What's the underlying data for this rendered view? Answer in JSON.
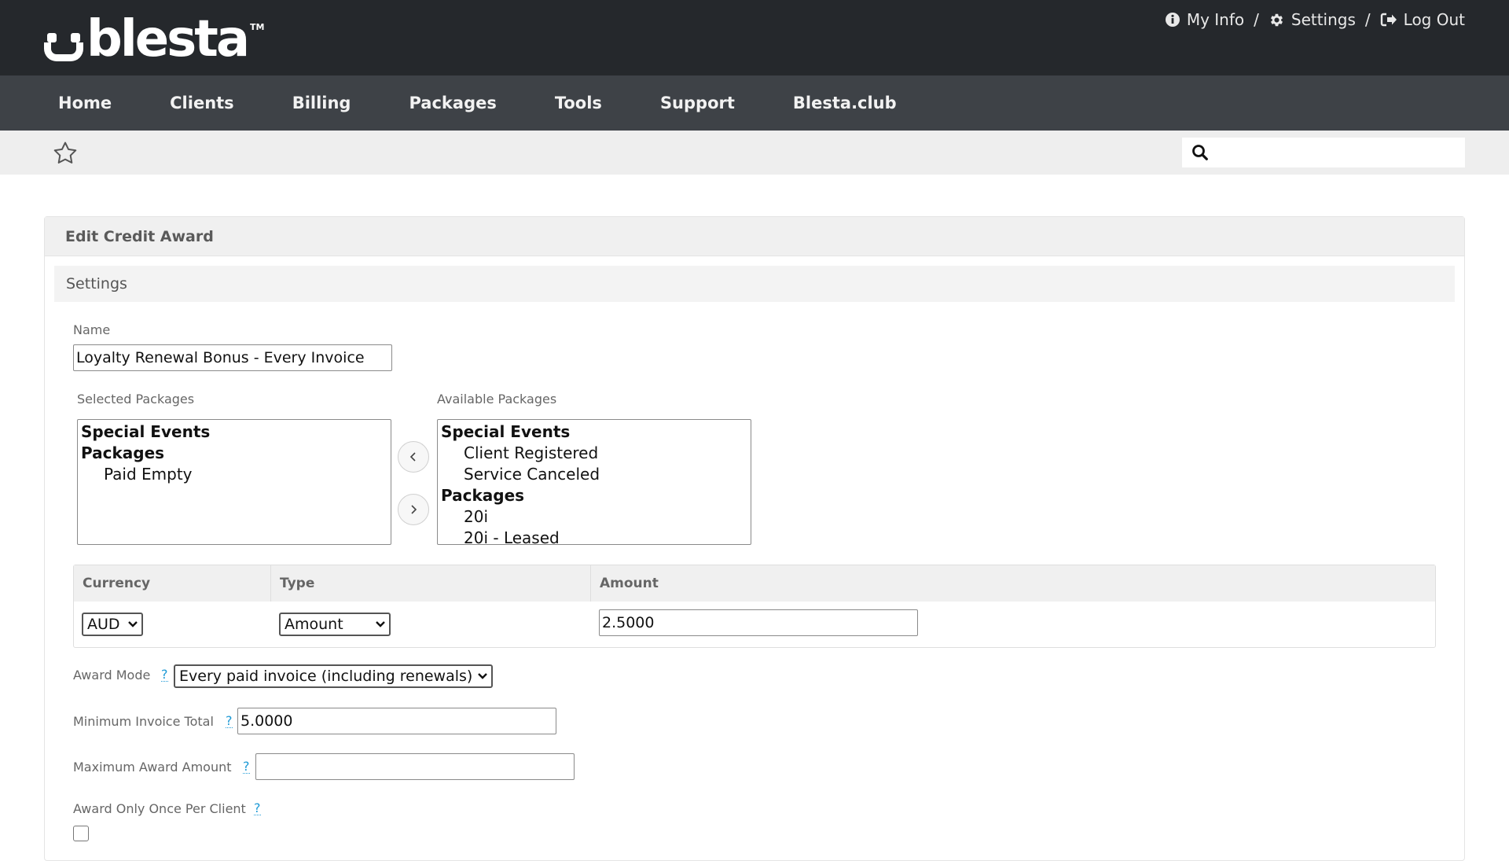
{
  "brand": {
    "name": "blesta",
    "tm": "TM"
  },
  "user_links": [
    {
      "label": "My Info",
      "icon": "info-icon"
    },
    {
      "label": "Settings",
      "icon": "gear-icon"
    },
    {
      "label": "Log Out",
      "icon": "logout-icon"
    }
  ],
  "separator": "/",
  "nav": [
    "Home",
    "Clients",
    "Billing",
    "Packages",
    "Tools",
    "Support",
    "Blesta.club"
  ],
  "search": {
    "placeholder": "",
    "value": ""
  },
  "panel": {
    "title": "Edit Credit Award",
    "section": "Settings"
  },
  "form": {
    "name_label": "Name",
    "name_value": "Loyalty Renewal Bonus - Every Invoice",
    "selected_packages_label": "Selected Packages",
    "selected_packages": [
      {
        "text": "Special Events",
        "group": true
      },
      {
        "text": "Packages",
        "group": true
      },
      {
        "text": "Paid Empty",
        "group": false
      }
    ],
    "available_packages_label": "Available Packages",
    "available_packages": [
      {
        "text": "Special Events",
        "group": true
      },
      {
        "text": "Client Registered",
        "group": false
      },
      {
        "text": "Service Canceled",
        "group": false
      },
      {
        "text": "Packages",
        "group": true
      },
      {
        "text": "20i",
        "group": false
      },
      {
        "text": "20i - Leased",
        "group": false
      }
    ],
    "table_headers": {
      "currency": "Currency",
      "type": "Type",
      "amount": "Amount"
    },
    "currency_value": "AUD",
    "type_value": "Amount",
    "amount_value": "2.5000",
    "award_mode_label": "Award Mode",
    "award_mode_value": "Every paid invoice (including renewals)",
    "min_total_label": "Minimum Invoice Total",
    "min_total_value": "5.0000",
    "max_award_label": "Maximum Award Amount",
    "max_award_value": "",
    "once_per_client_label": "Award Only Once Per Client",
    "once_per_client_checked": false,
    "help_glyph": "?"
  },
  "colors": {
    "header": "#25282c",
    "nav": "#3e4247",
    "subbar": "#eeeeee",
    "help": "#1e9ad6"
  }
}
